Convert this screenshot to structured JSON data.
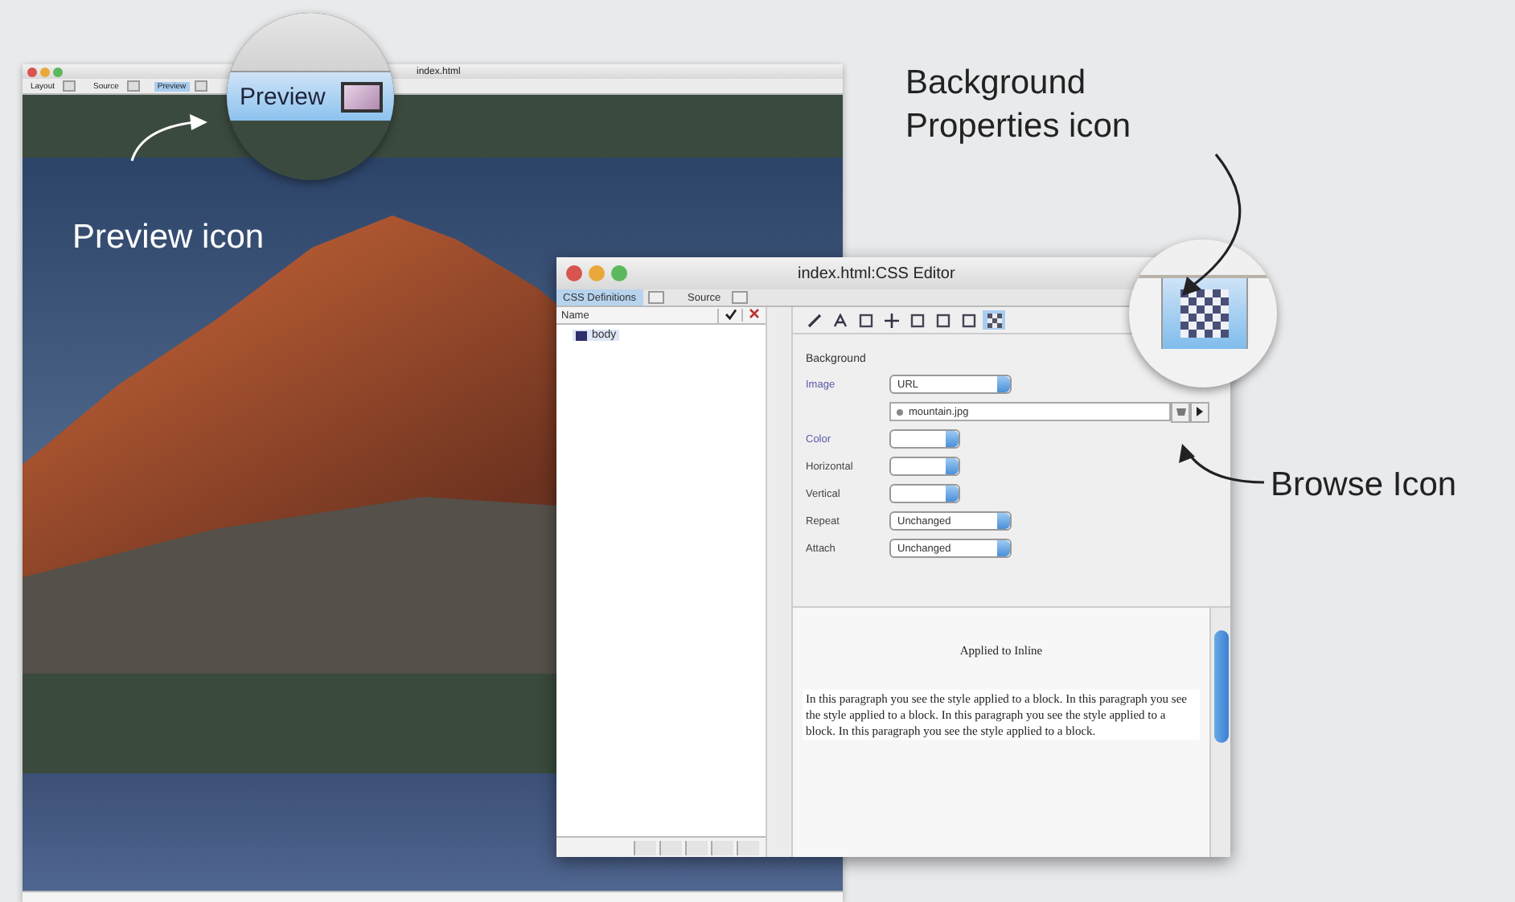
{
  "main_window": {
    "title": "index.html",
    "toolbar": [
      {
        "label": "Layout",
        "selected": false
      },
      {
        "label": "Source",
        "selected": false
      },
      {
        "label": "Preview",
        "selected": true
      }
    ]
  },
  "magnifier_preview": {
    "label": "Preview"
  },
  "callouts": [
    {
      "text": "Preview icon"
    },
    {
      "text": "Background Properties icon"
    },
    {
      "text": "Browse Icon"
    }
  ],
  "css_editor": {
    "title": "index.html:CSS Editor",
    "tabs": [
      {
        "label": "CSS Definitions",
        "selected": true
      },
      {
        "label": "Source",
        "selected": false
      }
    ],
    "list_header": "Name",
    "items": [
      {
        "label": "body",
        "selected": true
      }
    ],
    "tools": [
      {
        "selected": false
      },
      {
        "selected": false
      },
      {
        "selected": false
      },
      {
        "selected": false
      },
      {
        "selected": false
      },
      {
        "selected": false
      },
      {
        "selected": false
      },
      {
        "selected": true
      }
    ],
    "section": "Background",
    "properties": [
      {
        "kind": "select",
        "label": "Image",
        "value": "URL",
        "emphasized": true
      },
      {
        "kind": "file",
        "value": "mountain.jpg"
      },
      {
        "kind": "color",
        "label": "Color",
        "emphasized": true
      },
      {
        "kind": "select",
        "label": "Horizontal",
        "emphasized": false
      },
      {
        "kind": "select",
        "label": "Vertical",
        "emphasized": false
      },
      {
        "kind": "select",
        "label": "Repeat",
        "value": "Unchanged",
        "emphasized": false
      },
      {
        "kind": "select",
        "label": "Attach",
        "value": "Unchanged",
        "emphasized": false
      }
    ],
    "preview": {
      "heading": "Applied to Inline",
      "paragraph": "In this paragraph you see the style applied to a block. In this paragraph you see the style applied to a block. In this paragraph you see the style applied to a block. In this paragraph you see the style applied to a block."
    }
  }
}
